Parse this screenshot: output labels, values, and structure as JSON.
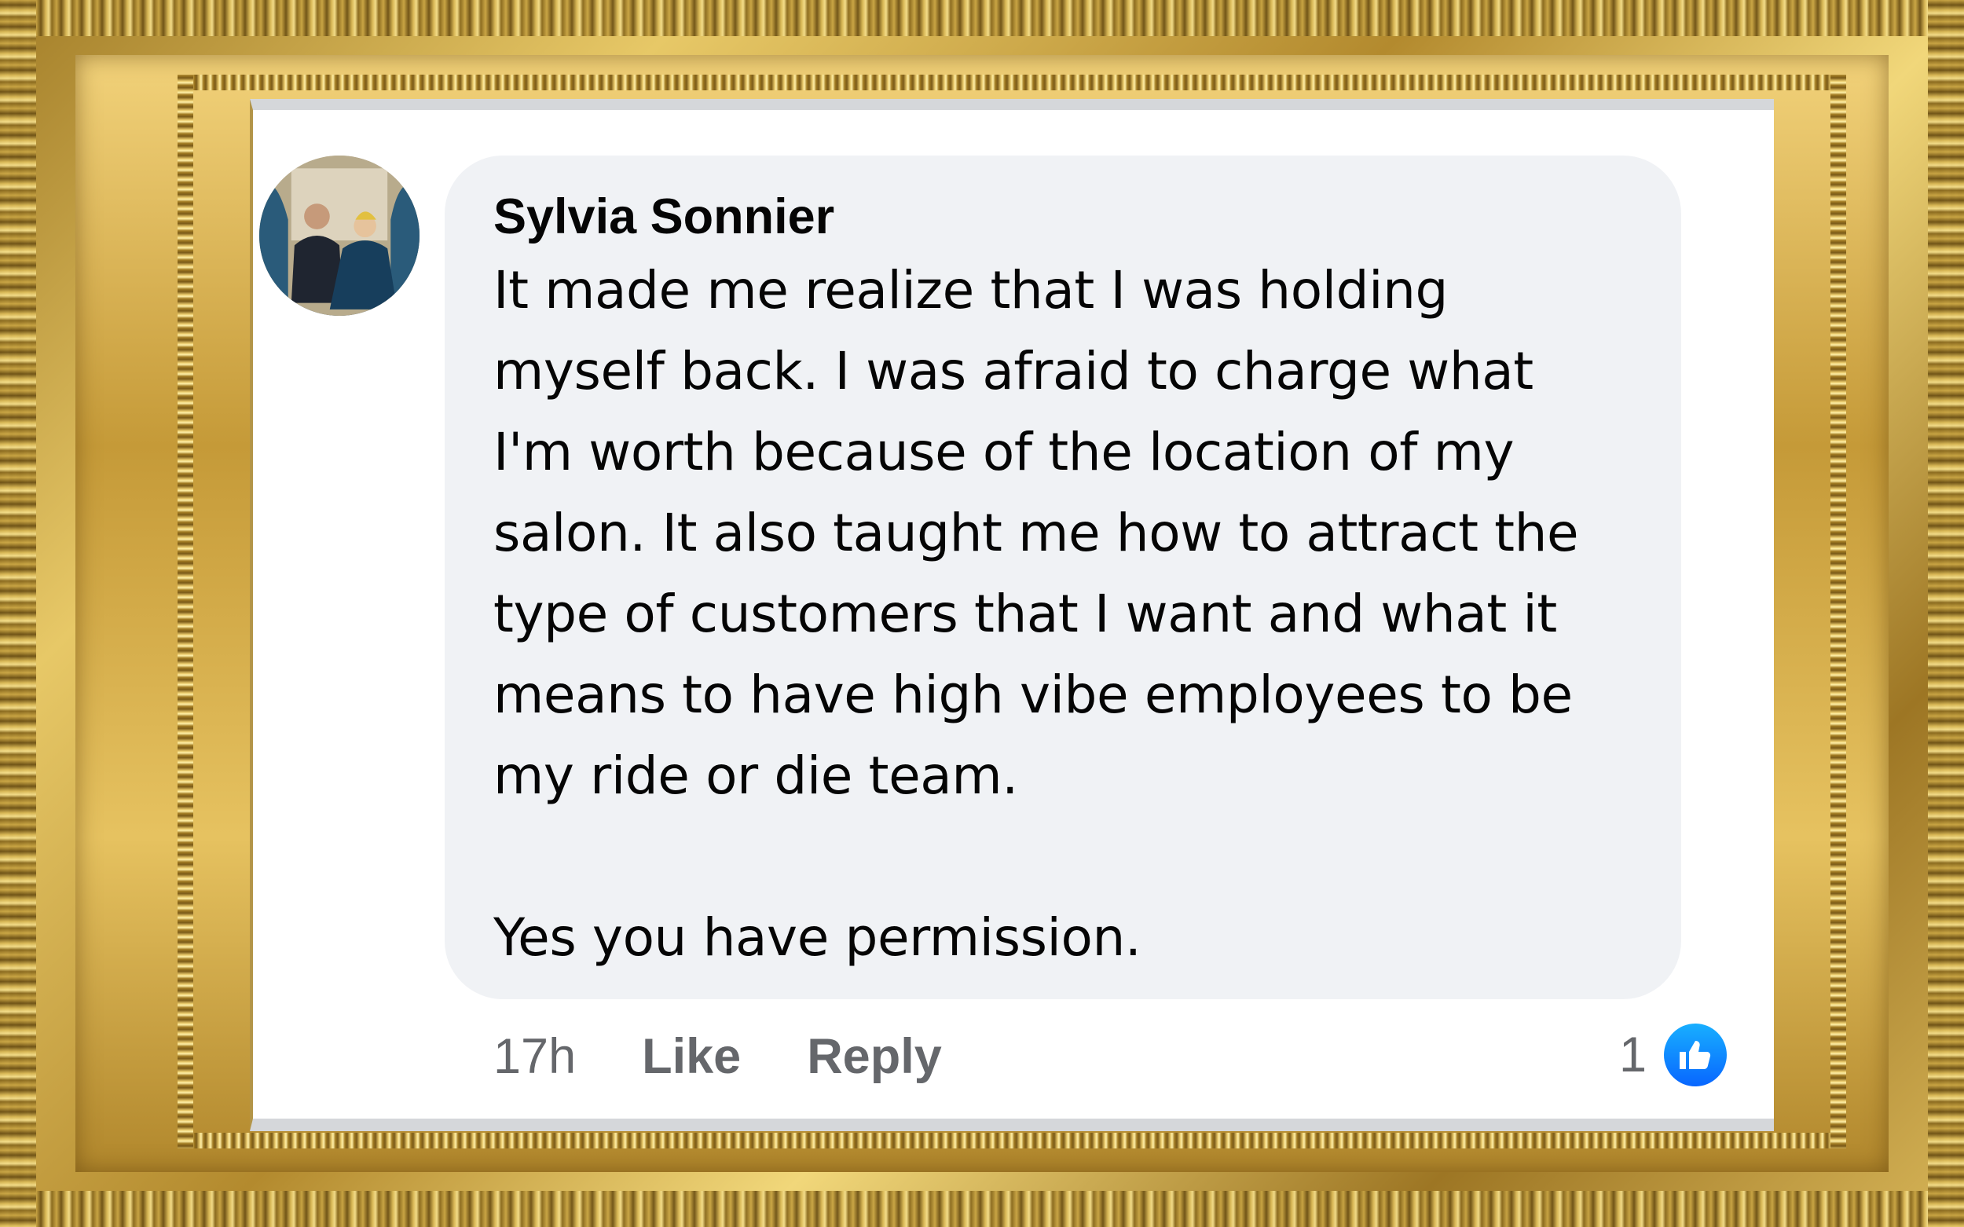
{
  "comment": {
    "author": "Sylvia Sonnier",
    "text": "It made me realize that I was holding\nmyself back. I was afraid to charge what\nI'm worth because of the location of my\nsalon. It also taught me how to attract the\ntype of customers that I want and what it\nmeans to have high vibe employees to be\nmy ride or die team.\n\nYes you have permission.",
    "timestamp": "17h",
    "like_label": "Like",
    "reply_label": "Reply",
    "reaction_count": "1",
    "reaction_icon": "like-icon"
  },
  "colors": {
    "bubble": "#f0f2f5",
    "text": "#050505",
    "secondary_text": "#65676b",
    "like_blue": "#0866ff",
    "frame_gold": "#c9a544"
  }
}
